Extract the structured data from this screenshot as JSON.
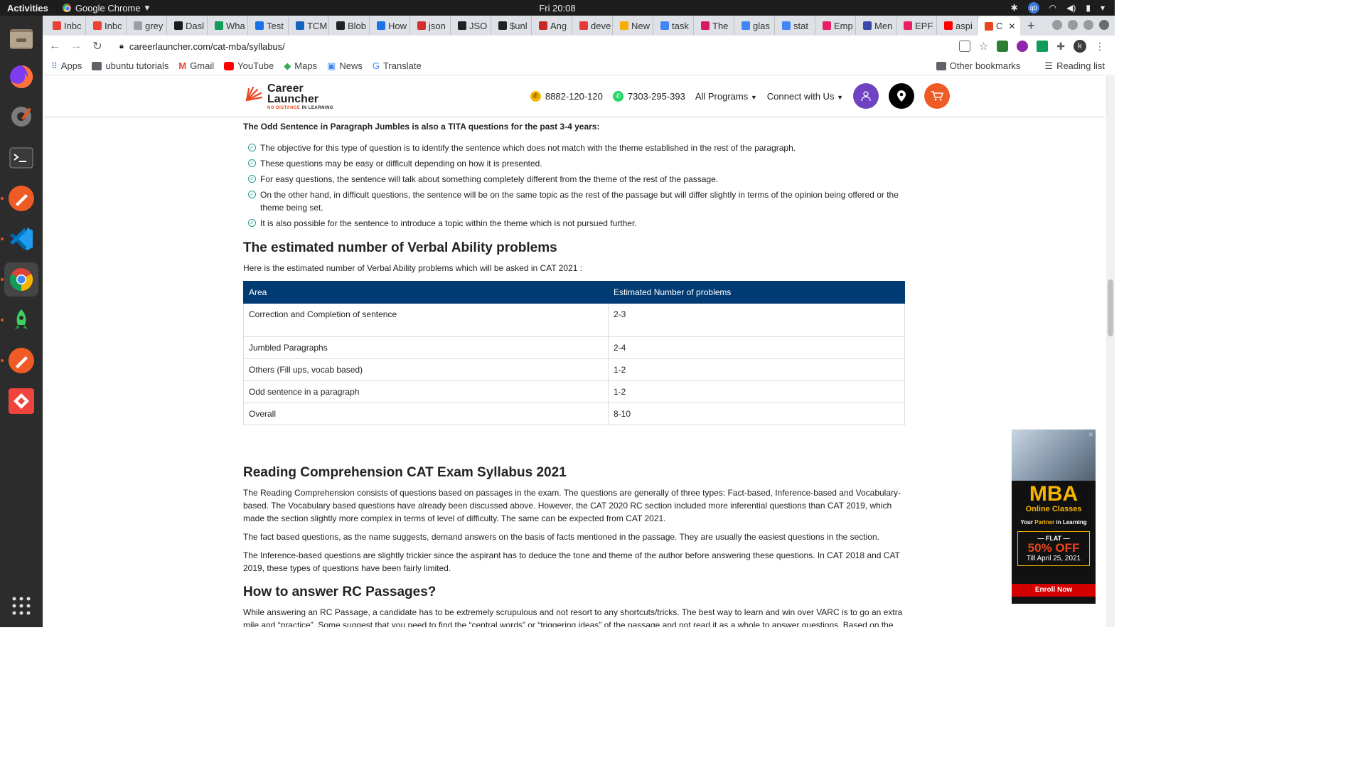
{
  "system_bar": {
    "activities": "Activities",
    "app_name": "Google Chrome",
    "clock": "Fri 20:08",
    "user_initials": "qb"
  },
  "tabs": [
    {
      "label": "Inbc",
      "color": "#ea4335"
    },
    {
      "label": "Inbc",
      "color": "#ea4335"
    },
    {
      "label": "grey",
      "color": "#9aa0a6"
    },
    {
      "label": "Dasl",
      "color": "#1a1a1a"
    },
    {
      "label": "Wha",
      "color": "#0f9d58"
    },
    {
      "label": "Test",
      "color": "#1a73e8"
    },
    {
      "label": "TCM",
      "color": "#1565c0"
    },
    {
      "label": "Blob",
      "color": "#202124"
    },
    {
      "label": "How",
      "color": "#1a73e8"
    },
    {
      "label": "json",
      "color": "#d32f2f"
    },
    {
      "label": "JSO",
      "color": "#202124"
    },
    {
      "label": "$unl",
      "color": "#202124"
    },
    {
      "label": "Ang",
      "color": "#c62828"
    },
    {
      "label": "deve",
      "color": "#e53935"
    },
    {
      "label": "New",
      "color": "#f9ab00"
    },
    {
      "label": "task",
      "color": "#4285f4"
    },
    {
      "label": "The",
      "color": "#d81b60"
    },
    {
      "label": "glas",
      "color": "#4285f4"
    },
    {
      "label": "stat",
      "color": "#4285f4"
    },
    {
      "label": "Emp",
      "color": "#e91e63"
    },
    {
      "label": "Men",
      "color": "#3949ab"
    },
    {
      "label": "EPF",
      "color": "#e91e63"
    },
    {
      "label": "aspi",
      "color": "#ff0000"
    }
  ],
  "active_tab": {
    "label": "C",
    "close": "✕"
  },
  "new_tab": "+",
  "address_bar": {
    "url": "careerlauncher.com/cat-mba/syllabus/"
  },
  "profile_initial": "k",
  "bookmarks": {
    "items": [
      "Apps",
      "ubuntu tutorials",
      "Gmail",
      "YouTube",
      "Maps",
      "News",
      "Translate"
    ],
    "other": "Other bookmarks",
    "reading_list": "Reading list"
  },
  "site_header": {
    "logo_line1": "Career",
    "logo_line2": "Launcher",
    "logo_tag_a": "NO DISTANCE",
    "logo_tag_b": "IN LEARNING",
    "phone1": "8882-120-120",
    "phone2": "7303-295-393",
    "programs": "All Programs",
    "connect": "Connect with Us"
  },
  "content": {
    "lead": "The Odd Sentence in Paragraph Jumbles is also a TITA questions for the past 3-4 years:",
    "bullets": [
      "The objective for this type of question is to identify the sentence which does not match with the theme established in the rest of the paragraph.",
      "These questions may be easy or difficult depending on how it is presented.",
      "For easy questions, the sentence will talk about something completely different from the theme of the rest of the passage.",
      "On the other hand, in difficult questions, the sentence will be on the same topic as the rest of the passage but will differ slightly in terms of the opinion being offered or the theme being set.",
      "It is also possible for the sentence to introduce a topic within the theme which is not pursued further."
    ],
    "va_heading": "The estimated number of Verbal Ability problems",
    "va_intro": "Here is the estimated number of Verbal Ability problems which will be asked in CAT 2021 :",
    "table": {
      "headers": [
        "Area",
        "Estimated Number of problems"
      ],
      "rows": [
        [
          "Correction and Completion of sentence",
          "2-3"
        ],
        [
          "Jumbled Paragraphs",
          "2-4"
        ],
        [
          "Others (Fill ups, vocab based)",
          "1-2"
        ],
        [
          "Odd sentence in a paragraph",
          "1-2"
        ],
        [
          "Overall",
          "8-10"
        ]
      ]
    },
    "rc_heading": "Reading Comprehension CAT Exam Syllabus 2021",
    "rc_p1": "The Reading Comprehension consists of questions based on passages in the exam. The questions are generally of three types: Fact-based, Inference-based and Vocabulary-based. The Vocabulary based questions have already been discussed above. However, the CAT 2020 RC section included more inferential questions than CAT 2019, which made the section slightly more complex in terms of level of difficulty. The same can be expected from CAT 2021.",
    "rc_p2": "The fact based questions, as the name suggests, demand answers on the basis of facts mentioned in the passage. They are usually the easiest questions in the section.",
    "rc_p3": "The Inference-based questions are slightly trickier since the aspirant has to deduce the tone and theme of the author before answering these questions. In CAT 2018 and CAT 2019, these types of questions have been fairly limited.",
    "howto_heading": "How to answer RC Passages?",
    "howto_p": "While answering an RC Passage, a candidate has to be extremely scrupulous and not resort to any shortcuts/tricks. The best way to learn and win over VARC is to go an extra mile and “practice”. Some suggest that you need to find the “central words” or “triggering ideas” of the passage and not read it as a whole to answer questions. Based on the experience of"
  },
  "ad": {
    "title": "MBA",
    "subtitle": "Online Classes",
    "partner_a": "Your",
    "partner_b": "Partner",
    "partner_c": "in Learning",
    "flat": "— FLAT —",
    "percent": "50% OFF",
    "till": "Till April 25, 2021",
    "cta": "Enroll Now",
    "close": "✕"
  },
  "colors": {
    "table_header": "#003b73",
    "brand_orange": "#e8461e",
    "check_teal": "#2a9b8e"
  }
}
